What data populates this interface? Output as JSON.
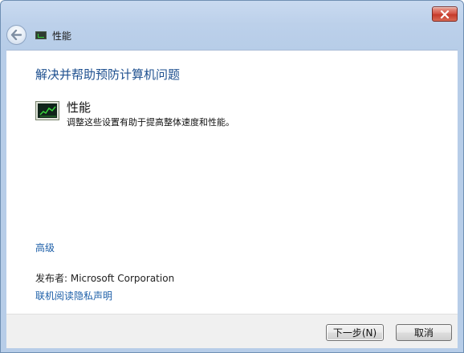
{
  "window": {
    "title": "性能",
    "close_icon": "close-icon",
    "back_icon": "back-arrow-icon",
    "title_icon": "performance-monitor-icon",
    "accent": "#1d4f8f",
    "close_color": "#c53a2b"
  },
  "main": {
    "heading": "解决并帮助预防计算机问题",
    "item": {
      "icon": "performance-monitor-icon",
      "title": "性能",
      "description": "调整这些设置有助于提高整体速度和性能。"
    },
    "advanced_link": "高级",
    "publisher": "发布者:  Microsoft Corporation",
    "privacy_link": "联机阅读隐私声明"
  },
  "footer": {
    "next_label": "下一步(N)",
    "cancel_label": "取消"
  }
}
